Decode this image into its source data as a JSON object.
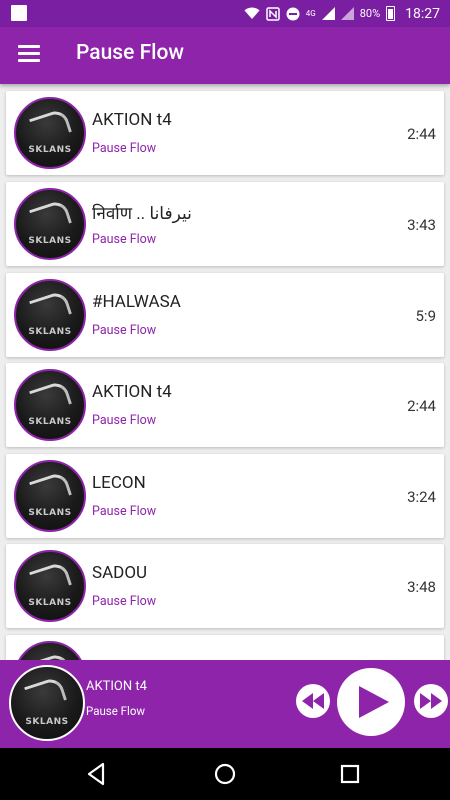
{
  "status_bar": {
    "battery": "80%",
    "time": "18:27",
    "signal_label": "4G"
  },
  "app_bar": {
    "title": "Pause Flow",
    "menu_icon": "hamburger-menu-icon"
  },
  "tracks": [
    {
      "title": "AKTION t4",
      "artist": "Pause Flow",
      "duration": "2:44"
    },
    {
      "title": "निर्वाण .. نيرفانا",
      "artist": "Pause Flow",
      "duration": "3:43"
    },
    {
      "title": "#HALWASA",
      "artist": "Pause Flow",
      "duration": "5:9"
    },
    {
      "title": "AKTION t4",
      "artist": "Pause Flow",
      "duration": "2:44"
    },
    {
      "title": "LECON",
      "artist": "Pause Flow",
      "duration": "3:24"
    },
    {
      "title": "SADOU",
      "artist": "Pause Flow",
      "duration": "3:48"
    },
    {
      "title": "",
      "artist": "",
      "duration": ""
    }
  ],
  "album_art_text": "SKLANS",
  "now_playing": {
    "title": "AKTION t4",
    "artist": "Pause Flow",
    "state": "paused"
  },
  "colors": {
    "primary": "#8e24aa",
    "primary_dark": "#7b1fa2",
    "accent_text": "#8e24aa"
  }
}
